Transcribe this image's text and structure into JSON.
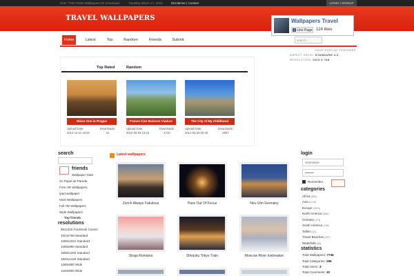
{
  "topbar": {
    "tagline": "Over 7746 Travel Wallpapers for Download",
    "date": "Tuesday March 17, 2015",
    "links": "Disclaimer | Contact",
    "login": "LOGIN | SIGNUP"
  },
  "header": {
    "logo": "TRAVEL WALLPAPERS",
    "fb_page": "Wallpapers Travel",
    "fb_like": "Like Page",
    "fb_likes": "124 likes"
  },
  "nav": {
    "items": [
      "Home",
      "Latest",
      "Top",
      "Random",
      "Friends",
      "Submit"
    ],
    "search_placeholder": "search..."
  },
  "display": {
    "heading": "YOUR DISPLAY FEATURES",
    "aspect_label": "ASPECT RATIO:",
    "aspect_value": "STANDARD 4:3",
    "res_label": "RESOLUTION:",
    "res_value": "1024 X 768"
  },
  "tabs": [
    "Top Rated",
    "Random"
  ],
  "featured": [
    {
      "title": "Nikon One in Prague",
      "date_label": "Upload Date:",
      "date": "2012-12-11 19:04",
      "dl_label": "Downloads:",
      "downloads": "31"
    },
    {
      "title": "France Cize-Bolozon Viaduct",
      "date_label": "Upload Date:",
      "date": "2012-04-04 13:43",
      "dl_label": "Downloads:",
      "downloads": "4710"
    },
    {
      "title": "The City of My Childhood",
      "date_label": "Upload Date:",
      "date": "2012-03-29 02:39",
      "dl_label": "Downloads:",
      "downloads": "3997"
    }
  ],
  "sidebar_left": {
    "search_heading": "search",
    "friends_heading": "friends",
    "friends": [
      "Wallpaper Gate",
      "So Papel de Parede",
      "Free HD Wallpapers",
      "Ipad wallpaper",
      "Most Wallpapers",
      "Full HD Wallpapers",
      "Wide Wallpapers",
      "Top friends"
    ],
    "resolutions_heading": "resolutions",
    "resolutions": [
      "851x315 Facebook Covers",
      "1024x768 Standard",
      "1280x1024 Standard",
      "1280x960 Standard",
      "1600x1200 Standard",
      "1920x1440 Standard",
      "1280x800 Wide",
      "1440x900 Wide"
    ]
  },
  "latest": {
    "heading": "Latest wallpapers",
    "items": [
      "Zurich Always Fabulous",
      "Paris Out Of Focus",
      "Neu Ulm Germany",
      "Straja Romania",
      "Shinjuku Tokyo Train",
      "Moscow River Icebreaker"
    ]
  },
  "sidebar_right": {
    "login_heading": "login",
    "username": "Username",
    "password": "••••••••",
    "remember": "Remember",
    "categories_heading": "categories",
    "categories": [
      {
        "name": "Africa",
        "count": "(563)"
      },
      {
        "name": "Asia",
        "count": "(2176)"
      },
      {
        "name": "Europe",
        "count": "(4003)"
      },
      {
        "name": "North America",
        "count": "(656)"
      },
      {
        "name": "Oceania",
        "count": "(173)"
      },
      {
        "name": "South America",
        "count": "(158)"
      },
      {
        "name": "Tallinn",
        "count": "(12)"
      },
      {
        "name": "Travel Beaches",
        "count": "(397)"
      },
      {
        "name": "Waterfalls",
        "count": "(84)"
      }
    ],
    "statistics_heading": "statistics",
    "stats": [
      {
        "label": "Total Wallpapers:",
        "value": "7746"
      },
      {
        "label": "Total Categories:",
        "value": "296"
      },
      {
        "label": "Total Users:",
        "value": "3"
      },
      {
        "label": "Total Comments:",
        "value": "10"
      }
    ]
  },
  "colors": {
    "accent": "#e0321b",
    "header": "#e83a1f",
    "orange": "#f28a1a"
  }
}
